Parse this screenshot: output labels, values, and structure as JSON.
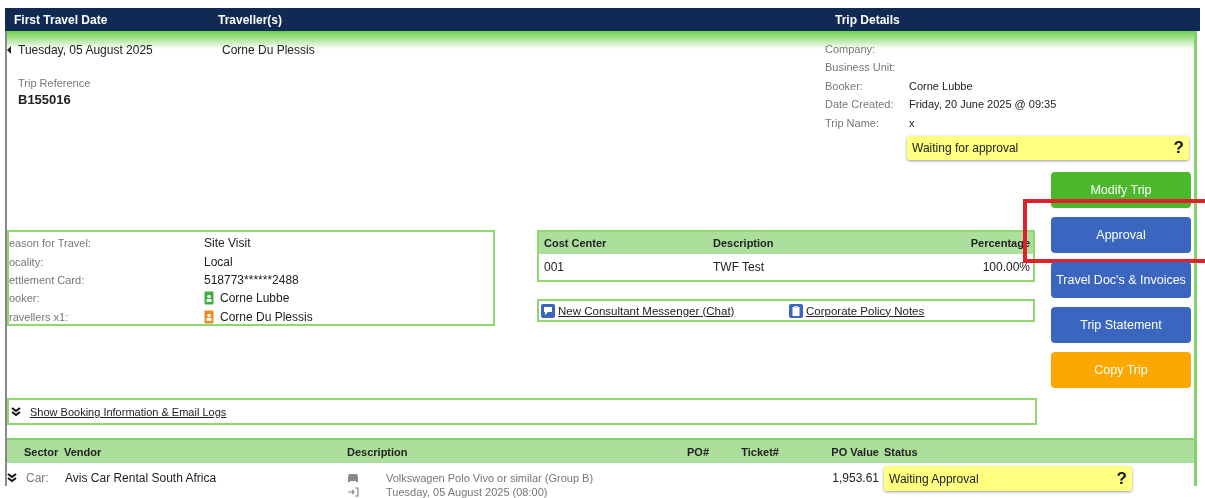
{
  "header": {
    "columns": [
      "First Travel Date",
      "Traveller(s)",
      "Trip Details"
    ]
  },
  "trip": {
    "first_travel_date": "Tuesday, 05 August 2025",
    "traveller": "Corne Du Plessis",
    "reference_label": "Trip Reference",
    "reference": "B155016"
  },
  "trip_details": [
    {
      "label": "Company:"
    },
    {
      "label": "Business Unit:"
    },
    {
      "label": "Booker:",
      "value": "Corne Lubbe"
    },
    {
      "label": "Date Created:",
      "value": "Friday, 20 June 2025 @ 09:35"
    },
    {
      "label": "Trip Name:",
      "value": "x"
    }
  ],
  "trip_status": {
    "text": "Waiting for approval",
    "help": "?"
  },
  "actions": [
    {
      "label": "Modify Trip",
      "color": "#4cb82c",
      "highlighted": false
    },
    {
      "label": "Approval",
      "color": "#3a66c0",
      "highlighted": true
    },
    {
      "label": "Travel Doc's & Invoices",
      "color": "#3a66c0",
      "highlighted": false
    },
    {
      "label": "Trip Statement",
      "color": "#3a66c0",
      "highlighted": false
    },
    {
      "label": "Copy Trip",
      "color": "#fca800",
      "highlighted": false
    }
  ],
  "trip_info": [
    {
      "label": "eason for Travel:",
      "value": "Site Visit",
      "kind": "plain"
    },
    {
      "label": "ocality:",
      "value": "Local",
      "kind": "plain"
    },
    {
      "label": "ettlement Card:",
      "value": "518773******2488",
      "kind": "plain"
    },
    {
      "label": "ooker:",
      "value": "Corne Lubbe",
      "kind": "booker"
    },
    {
      "label": "ravellers x1:",
      "value": "Corne Du Plessis",
      "kind": "traveller"
    }
  ],
  "cost_centers": {
    "columns": [
      "Cost Center",
      "Description",
      "Percentage"
    ],
    "rows": [
      [
        "001",
        "TWF Test",
        "100.00%"
      ]
    ]
  },
  "links": [
    "New Consultant Messenger (Chat)",
    "Corporate Policy Notes"
  ],
  "booking_toggle": "Show Booking Information & Email Logs",
  "sectors": {
    "columns": [
      "Sector",
      "Vendor",
      "Description",
      "PO#",
      "Ticket#",
      "PO Value",
      "Status"
    ],
    "rows": [
      {
        "sector": "Car:",
        "vendor": "Avis Car Rental South Africa",
        "description": [
          "Volkswagen Polo Vivo or similar (Group B)",
          "Tuesday, 05 August 2025 (08:00)"
        ],
        "po_value": "1,953.61",
        "status": "Waiting Approval",
        "help": "?"
      }
    ]
  }
}
